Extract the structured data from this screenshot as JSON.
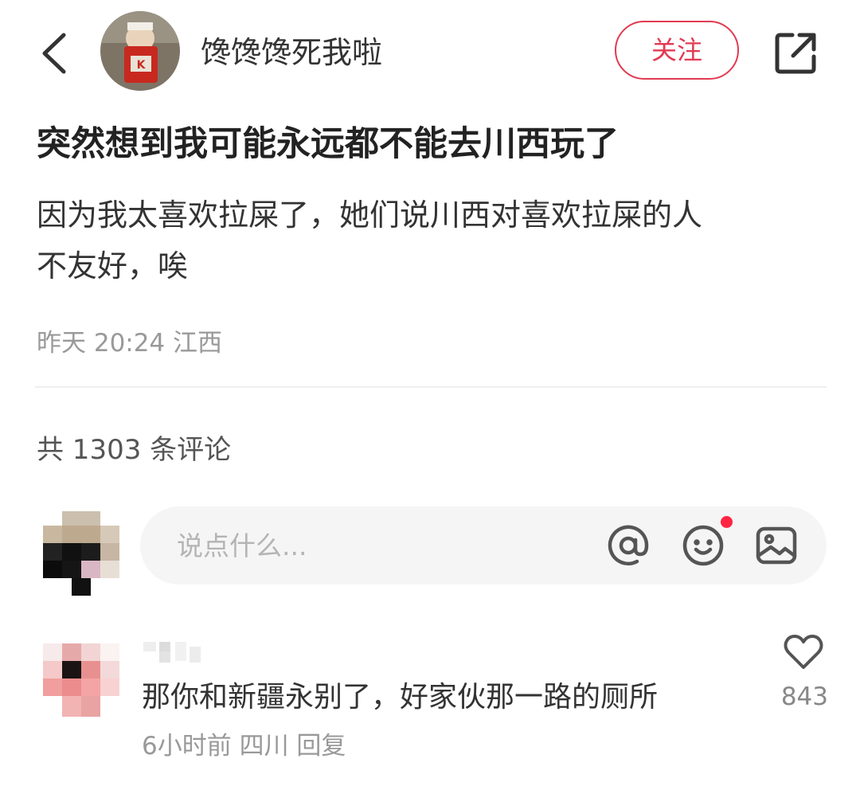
{
  "header": {
    "username": "馋馋馋死我啦",
    "follow_label": "关注"
  },
  "post": {
    "title": "突然想到我可能永远都不能去川西玩了",
    "body_line1": "因为我太喜欢拉屎了，她们说川西对喜欢拉屎的人",
    "body_line2": "不友好，唉",
    "meta": "昨天 20:24 江西"
  },
  "comments_section": {
    "count_label": "共 1303 条评论",
    "input_placeholder": "说点什么..."
  },
  "comment": {
    "text": "那你和新疆永别了，好家伙那一路的厕所",
    "meta": "6小时前 四川 回复",
    "likes": "843"
  },
  "colors": {
    "accent": "#e23a52",
    "notification_dot": "#ff2442",
    "input_bg": "#f5f5f5",
    "muted_text": "#999999"
  },
  "icons": [
    "back-icon",
    "share-icon",
    "at-icon",
    "emoji-icon",
    "image-icon",
    "heart-icon"
  ]
}
